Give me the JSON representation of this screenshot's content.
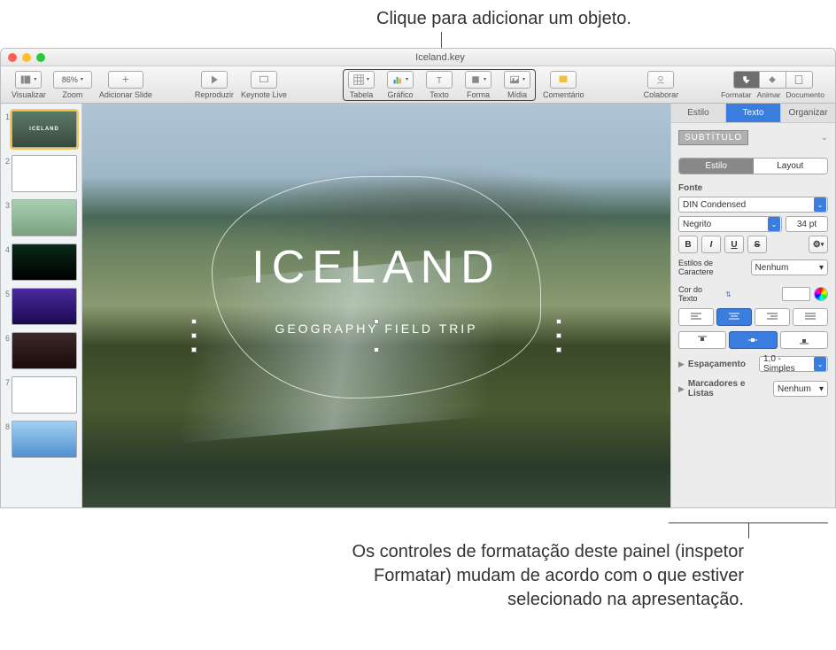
{
  "callouts": {
    "top": "Clique para adicionar um objeto.",
    "bottom": "Os controles de formatação deste painel (inspetor Formatar) mudam de acordo com o que estiver selecionado na apresentação."
  },
  "titlebar": {
    "filename": "Iceland.key"
  },
  "toolbar": {
    "view": "Visualizar",
    "zoom": "Zoom",
    "zoom_value": "86%",
    "add_slide": "Adicionar Slide",
    "play": "Reproduzir",
    "keynote_live": "Keynote Live",
    "table": "Tabela",
    "chart": "Gráfico",
    "text": "Texto",
    "shape": "Forma",
    "media": "Mídia",
    "comment": "Comentário",
    "collaborate": "Colaborar",
    "format": "Formatar",
    "animate": "Animar",
    "document": "Documento"
  },
  "thumbnails": [
    {
      "num": "1",
      "label": "ICELAND"
    },
    {
      "num": "2",
      "label": ""
    },
    {
      "num": "3",
      "label": ""
    },
    {
      "num": "4",
      "label": ""
    },
    {
      "num": "5",
      "label": ""
    },
    {
      "num": "6",
      "label": ""
    },
    {
      "num": "7",
      "label": ""
    },
    {
      "num": "8",
      "label": ""
    }
  ],
  "slide": {
    "title": "ICELAND",
    "subtitle": "GEOGRAPHY FIELD TRIP"
  },
  "inspector": {
    "tabs": {
      "style": "Estilo",
      "text": "Texto",
      "arrange": "Organizar"
    },
    "paragraph_style": "SUBTÍTULO",
    "subtabs": {
      "style": "Estilo",
      "layout": "Layout"
    },
    "font_label": "Fonte",
    "font_family": "DIN Condensed",
    "font_style": "Negrito",
    "font_size": "34 pt",
    "bold": "B",
    "italic": "I",
    "underline": "U",
    "strike": "S",
    "char_styles_label": "Estilos de Caractere",
    "char_styles_value": "Nenhum",
    "text_color_label": "Cor do Texto",
    "spacing_label": "Espaçamento",
    "spacing_value": "1,0 - Simples",
    "bullets_label": "Marcadores e Listas",
    "bullets_value": "Nenhum"
  }
}
